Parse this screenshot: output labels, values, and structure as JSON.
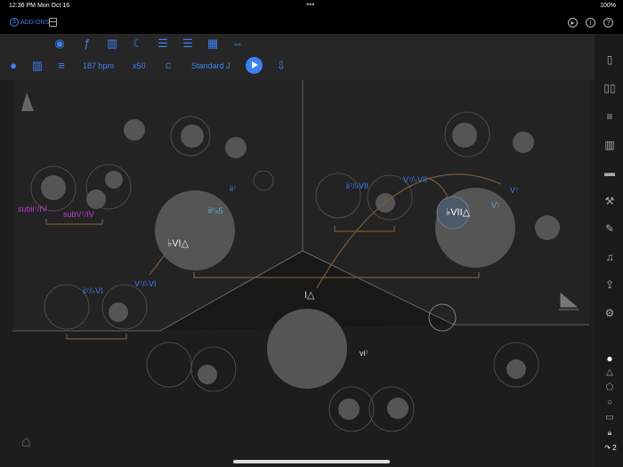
{
  "status": {
    "time": "12:36 PM",
    "date": "Mon Oct 16",
    "battery": "100%",
    "dots": "•••"
  },
  "header": {
    "addons_label": "ADD-ONS"
  },
  "toolbar": {
    "icons": [
      "eye-icon",
      "function-icon",
      "map-icon",
      "moon-icon",
      "list-minus-icon",
      "list-plus-icon",
      "grid-icon",
      "expand-icon"
    ],
    "tempo": "187 bpm",
    "multiplier": "x50",
    "key": "C",
    "tuning": "Standard J"
  },
  "sidebar": {
    "icons": [
      "device-icon",
      "book-icon",
      "sliders-icon",
      "map-icon",
      "layers-icon",
      "hammer-icon",
      "edit-icon",
      "music-list-icon",
      "share-icon",
      "gear-play-icon"
    ],
    "shapes": [
      "circle",
      "triangle",
      "pentagon",
      "hexagon",
      "rectangle",
      "lock"
    ],
    "counter": "2"
  },
  "chords": {
    "bVI": "♭VI△",
    "bVII": "♭VII△",
    "I": "I△",
    "vi": "vi⁷",
    "ii7": "ii⁷",
    "ii7b5": "ii⁷♭5",
    "V7": "V⁷",
    "V7b": "V⁷",
    "subii_IV": "subii⁷/IV",
    "subV_IV": "subV⁷/IV",
    "ii_bVI": "ii⁷/♭VI",
    "V_bVI": "V⁷/♭VI",
    "ii_bVII": "ii⁷/♭VII",
    "V_bVII": "V⁷/♭VII"
  },
  "colors": {
    "accent": "#3b82f6",
    "sub": "#c03ad0",
    "light": "#5ab4e8",
    "arrow": "#7a5a3c"
  }
}
